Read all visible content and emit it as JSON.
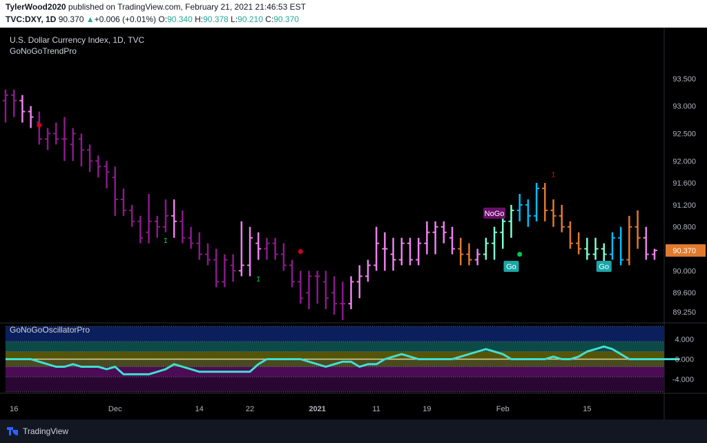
{
  "header": {
    "author": "TylerWood2020",
    "published": " published on TradingView.com, February 21, 2021 21:46:53 EST",
    "symbol": "TVC:DXY, 1D",
    "last": "90.370",
    "change_arrow": "▲",
    "change": "+0.006 (+0.01%)",
    "o_label": "O:",
    "o_value": "90.340",
    "h_label": "H:",
    "h_value": "90.378",
    "l_label": "L:",
    "l_value": "90.210",
    "c_label": "C:",
    "c_value": "90.370"
  },
  "footer": {
    "brand": "TradingView"
  },
  "colors": {
    "background": "#000000",
    "strong_nogo": "#8b1a8b",
    "weak_nogo": "#ee82ee",
    "strong_go": "#00bfff",
    "weak_go": "#7fffd4",
    "neutral": "#e07a2f",
    "oscillator_line": "#40e0d0",
    "zero_line": "#d8d8a0",
    "price_badge": "#e07a2f"
  },
  "chart_data": [
    {
      "type": "ohlc",
      "title": "U.S. Dollar Currency Index, 1D, TVC",
      "indicator": "GoNoGoTrendPro",
      "y_ticks": [
        "93.500",
        "93.000",
        "92.500",
        "92.000",
        "91.600",
        "91.200",
        "90.800",
        "90.370",
        "90.000",
        "89.600",
        "89.250"
      ],
      "y_tick_values": [
        93.5,
        93.0,
        92.5,
        92.0,
        91.6,
        91.2,
        90.8,
        90.4,
        90.0,
        89.6,
        89.25
      ],
      "last_price": "90.370",
      "x_ticks": [
        "16",
        "Dec",
        "14",
        "22",
        "2021",
        "11",
        "19",
        "Feb",
        "15"
      ],
      "x_tick_index": [
        1,
        13,
        23,
        29,
        37,
        44,
        50,
        59,
        69
      ],
      "bar_colors": [
        "s",
        "s",
        "w",
        "w",
        "s",
        "s",
        "s",
        "s",
        "s",
        "s",
        "s",
        "s",
        "s",
        "s",
        "s",
        "s",
        "s",
        "s",
        "s",
        "s",
        "w",
        "s",
        "s",
        "s",
        "s",
        "s",
        "s",
        "s",
        "w",
        "w",
        "w",
        "s",
        "s",
        "s",
        "s",
        "s",
        "s",
        "s",
        "s",
        "s",
        "s",
        "w",
        "w",
        "w",
        "w",
        "w",
        "w",
        "w",
        "w",
        "w",
        "w",
        "w",
        "w",
        "w",
        "n",
        "n",
        "w",
        "G",
        "G",
        "G",
        "G",
        "B",
        "B",
        "B",
        "n",
        "n",
        "n",
        "n",
        "n",
        "G",
        "G",
        "G",
        "B",
        "B",
        "n",
        "n"
      ],
      "bars": [
        [
          93.1,
          93.3,
          92.7,
          93.2
        ],
        [
          93.2,
          93.3,
          92.8,
          93.1
        ],
        [
          93.1,
          93.2,
          92.7,
          92.9
        ],
        [
          92.9,
          93.0,
          92.6,
          92.8
        ],
        [
          92.7,
          92.9,
          92.3,
          92.4
        ],
        [
          92.4,
          92.6,
          92.2,
          92.5
        ],
        [
          92.5,
          92.7,
          92.3,
          92.4
        ],
        [
          92.4,
          92.8,
          92.0,
          92.4
        ],
        [
          92.3,
          92.6,
          92.0,
          92.5
        ],
        [
          92.4,
          92.5,
          91.9,
          92.2
        ],
        [
          92.2,
          92.3,
          91.8,
          92.0
        ],
        [
          92.0,
          92.1,
          91.7,
          91.9
        ],
        [
          91.9,
          92.0,
          91.5,
          91.8
        ],
        [
          91.7,
          91.9,
          91.0,
          91.3
        ],
        [
          91.3,
          91.5,
          91.0,
          91.1
        ],
        [
          91.1,
          91.2,
          90.8,
          90.9
        ],
        [
          90.9,
          91.0,
          90.5,
          90.6
        ],
        [
          90.7,
          91.4,
          90.5,
          90.9
        ],
        [
          90.9,
          91.0,
          90.6,
          90.8
        ],
        [
          90.8,
          91.3,
          90.7,
          91.0
        ],
        [
          91.0,
          91.3,
          90.6,
          90.9
        ],
        [
          90.9,
          91.1,
          90.5,
          90.6
        ],
        [
          90.6,
          90.8,
          90.4,
          90.5
        ],
        [
          90.5,
          90.7,
          90.2,
          90.3
        ],
        [
          90.3,
          90.5,
          90.1,
          90.2
        ],
        [
          90.2,
          90.4,
          89.7,
          89.8
        ],
        [
          89.8,
          90.3,
          89.7,
          90.2
        ],
        [
          90.1,
          90.3,
          89.8,
          90.0
        ],
        [
          90.0,
          90.9,
          89.9,
          90.1
        ],
        [
          90.1,
          90.8,
          89.9,
          90.6
        ],
        [
          90.5,
          90.7,
          90.2,
          90.4
        ],
        [
          90.4,
          90.6,
          90.2,
          90.5
        ],
        [
          90.5,
          90.6,
          90.2,
          90.3
        ],
        [
          90.3,
          90.5,
          90.0,
          90.1
        ],
        [
          90.1,
          90.2,
          89.7,
          89.8
        ],
        [
          89.8,
          90.0,
          89.4,
          89.5
        ],
        [
          89.6,
          90.0,
          89.3,
          89.9
        ],
        [
          89.9,
          90.0,
          89.4,
          89.9
        ],
        [
          89.8,
          90.0,
          89.3,
          89.5
        ],
        [
          89.6,
          89.9,
          89.2,
          89.4
        ],
        [
          89.4,
          89.8,
          89.1,
          89.4
        ],
        [
          89.4,
          89.9,
          89.3,
          89.8
        ],
        [
          89.8,
          90.1,
          89.5,
          89.9
        ],
        [
          89.9,
          90.2,
          89.8,
          90.1
        ],
        [
          90.1,
          90.8,
          90.0,
          90.5
        ],
        [
          90.4,
          90.7,
          90.0,
          90.4
        ],
        [
          90.3,
          90.6,
          90.0,
          90.2
        ],
        [
          90.2,
          90.6,
          90.1,
          90.5
        ],
        [
          90.5,
          90.6,
          90.1,
          90.2
        ],
        [
          90.2,
          90.6,
          90.1,
          90.5
        ],
        [
          90.5,
          90.9,
          90.3,
          90.7
        ],
        [
          90.7,
          90.9,
          90.3,
          90.8
        ],
        [
          90.8,
          90.9,
          90.5,
          90.7
        ],
        [
          90.6,
          90.8,
          90.3,
          90.4
        ],
        [
          90.4,
          90.6,
          90.1,
          90.3
        ],
        [
          90.3,
          90.5,
          90.1,
          90.2
        ],
        [
          90.2,
          90.4,
          90.1,
          90.3
        ],
        [
          90.3,
          90.6,
          90.2,
          90.5
        ],
        [
          90.5,
          90.8,
          90.2,
          90.7
        ],
        [
          90.7,
          91.0,
          90.4,
          90.9
        ],
        [
          90.9,
          91.2,
          90.6,
          91.1
        ],
        [
          91.1,
          91.4,
          90.9,
          91.2
        ],
        [
          91.2,
          91.3,
          90.8,
          91.0
        ],
        [
          91.0,
          91.6,
          90.9,
          91.5
        ],
        [
          91.5,
          91.6,
          90.9,
          91.1
        ],
        [
          91.1,
          91.3,
          90.8,
          91.0
        ],
        [
          91.0,
          91.2,
          90.7,
          90.8
        ],
        [
          90.8,
          90.9,
          90.4,
          90.5
        ],
        [
          90.5,
          90.7,
          90.3,
          90.4
        ],
        [
          90.4,
          90.6,
          90.2,
          90.3
        ],
        [
          90.3,
          90.6,
          90.2,
          90.4
        ],
        [
          90.4,
          90.5,
          90.1,
          90.3
        ],
        [
          90.3,
          90.7,
          90.2,
          90.6
        ],
        [
          90.6,
          90.8,
          90.1,
          90.2
        ],
        [
          90.2,
          91.0,
          90.1,
          90.8
        ],
        [
          90.8,
          91.1,
          90.4,
          90.6
        ],
        [
          90.6,
          90.8,
          90.2,
          90.3
        ],
        [
          90.3,
          90.4,
          90.2,
          90.37
        ]
      ],
      "labels": [
        {
          "text": "NoGo",
          "bar": 58,
          "price": 91.05,
          "kind": "nogo"
        },
        {
          "text": "Go",
          "bar": 60,
          "price": 90.08,
          "kind": "go"
        },
        {
          "text": "Go",
          "bar": 71,
          "price": 90.08,
          "kind": "go"
        }
      ],
      "dots": [
        {
          "bar": 4,
          "price": 92.65,
          "color": "#d0021b"
        },
        {
          "bar": 35,
          "price": 90.35,
          "color": "#d0021b"
        },
        {
          "bar": 61,
          "price": 90.3,
          "color": "#00c853"
        }
      ],
      "ticks": [
        {
          "bar": 19,
          "price": 90.55,
          "color": "#00c853"
        },
        {
          "bar": 30,
          "price": 89.85,
          "color": "#00c853"
        },
        {
          "bar": 65,
          "price": 91.75,
          "color": "#d0021b"
        }
      ]
    },
    {
      "type": "line",
      "title": "GoNoGoOscillatorPro",
      "y_ticks": [
        "4.000",
        "0.000",
        "-4.000"
      ],
      "y_tick_values": [
        4,
        0,
        -4
      ],
      "values": [
        0,
        0,
        0,
        0,
        -0.5,
        -1,
        -1.5,
        -1.5,
        -1,
        -1.5,
        -1.5,
        -1.5,
        -2,
        -1.5,
        -3,
        -3,
        -3,
        -3,
        -2.5,
        -2,
        -1,
        -1.5,
        -2,
        -2.5,
        -2.5,
        -2.5,
        -2.5,
        -2.5,
        -2.5,
        -2.5,
        -1,
        0,
        0,
        0,
        0,
        0,
        -0.5,
        -1,
        -1.5,
        -1,
        -0.5,
        -0.5,
        -1.5,
        -1,
        -1,
        0,
        0.5,
        1,
        0.5,
        0,
        0,
        0,
        0,
        0,
        0.5,
        1,
        1.5,
        2,
        1.5,
        1,
        0,
        0,
        0,
        0,
        0,
        0.5,
        0,
        0,
        0.5,
        1.5,
        2,
        2.5,
        2,
        1,
        0,
        0,
        0,
        0,
        0,
        0,
        0
      ],
      "bands": [
        {
          "from": 6.5,
          "to": 3.5,
          "color": "#0a1f5c"
        },
        {
          "from": 3.5,
          "to": 1.5,
          "color": "#0c4a47"
        },
        {
          "from": 1.5,
          "to": 0,
          "color": "#55550a"
        },
        {
          "from": 0,
          "to": -1.5,
          "color": "#4a4a20"
        },
        {
          "from": -1.5,
          "to": -3.5,
          "color": "#4b0c55"
        },
        {
          "from": -3.5,
          "to": -6.5,
          "color": "#2a0733"
        }
      ]
    }
  ]
}
